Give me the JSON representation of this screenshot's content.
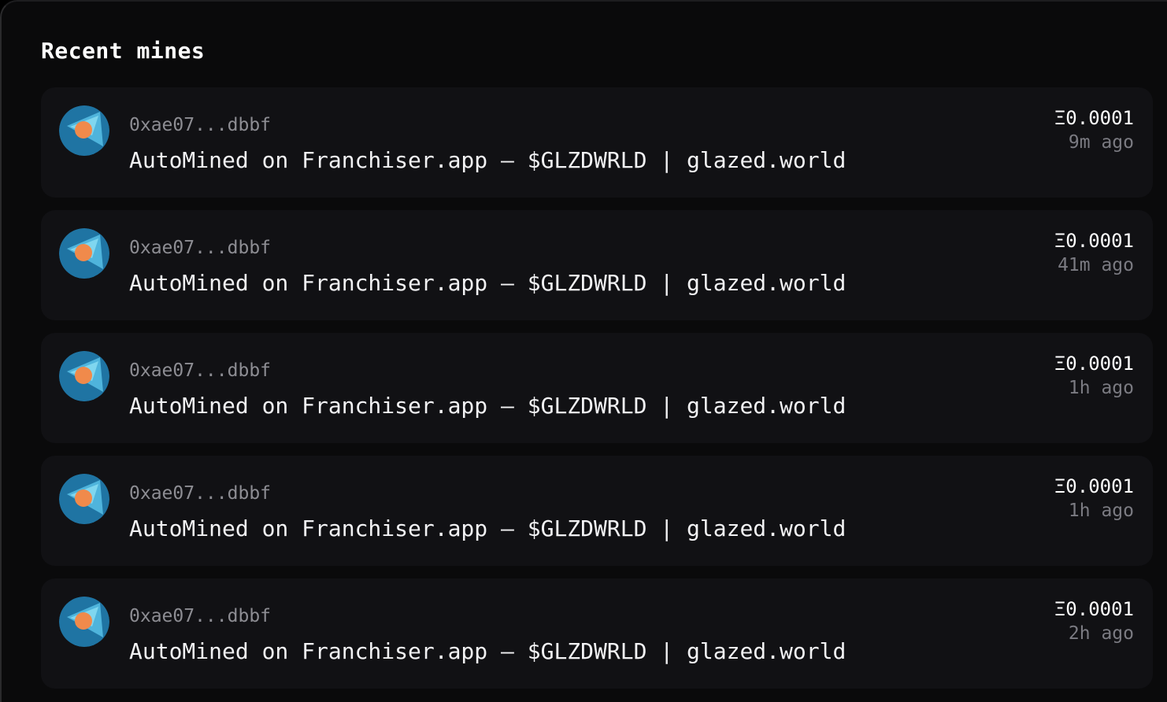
{
  "title": "Recent mines",
  "colors": {
    "avatar_bg": "#1f74a3",
    "avatar_triangle_light": "#7fd6ef",
    "avatar_triangle_mid": "#4fb4dc",
    "avatar_dot": "#f08a4b"
  },
  "mines": [
    {
      "avatar_icon": "miner-avatar-icon",
      "address": "0xae07...dbbf",
      "message": "AutoMined on Franchiser.app — $GLZDWRLD | glazed.world",
      "amount": "Ξ0.0001",
      "time": "9m ago"
    },
    {
      "avatar_icon": "miner-avatar-icon",
      "address": "0xae07...dbbf",
      "message": "AutoMined on Franchiser.app — $GLZDWRLD | glazed.world",
      "amount": "Ξ0.0001",
      "time": "41m ago"
    },
    {
      "avatar_icon": "miner-avatar-icon",
      "address": "0xae07...dbbf",
      "message": "AutoMined on Franchiser.app — $GLZDWRLD | glazed.world",
      "amount": "Ξ0.0001",
      "time": "1h ago"
    },
    {
      "avatar_icon": "miner-avatar-icon",
      "address": "0xae07...dbbf",
      "message": "AutoMined on Franchiser.app — $GLZDWRLD | glazed.world",
      "amount": "Ξ0.0001",
      "time": "1h ago"
    },
    {
      "avatar_icon": "miner-avatar-icon",
      "address": "0xae07...dbbf",
      "message": "AutoMined on Franchiser.app — $GLZDWRLD | glazed.world",
      "amount": "Ξ0.0001",
      "time": "2h ago"
    }
  ]
}
